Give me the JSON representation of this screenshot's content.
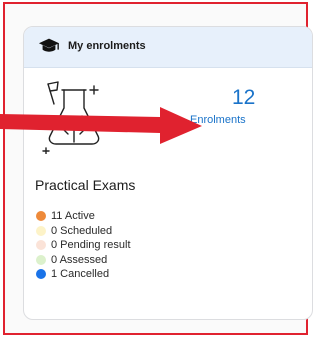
{
  "enrolments": {
    "header": {
      "title": "My enrolments",
      "icon": "graduation-cap-icon"
    },
    "summary": {
      "count": "12",
      "label": "Enrolments"
    },
    "section_title": "Practical Exams",
    "illustration": "lab-flask-icon",
    "statuses": [
      {
        "label": "11 Active",
        "color": "#ee8a3a"
      },
      {
        "label": "0 Scheduled",
        "color": "#fdf3c8"
      },
      {
        "label": "0 Pending result",
        "color": "#fbe3d8"
      },
      {
        "label": "0 Assessed",
        "color": "#dcf1cc"
      },
      {
        "label": "1 Cancelled",
        "color": "#1a73e8"
      }
    ]
  },
  "annotation": {
    "arrow_color": "#e0222f"
  }
}
